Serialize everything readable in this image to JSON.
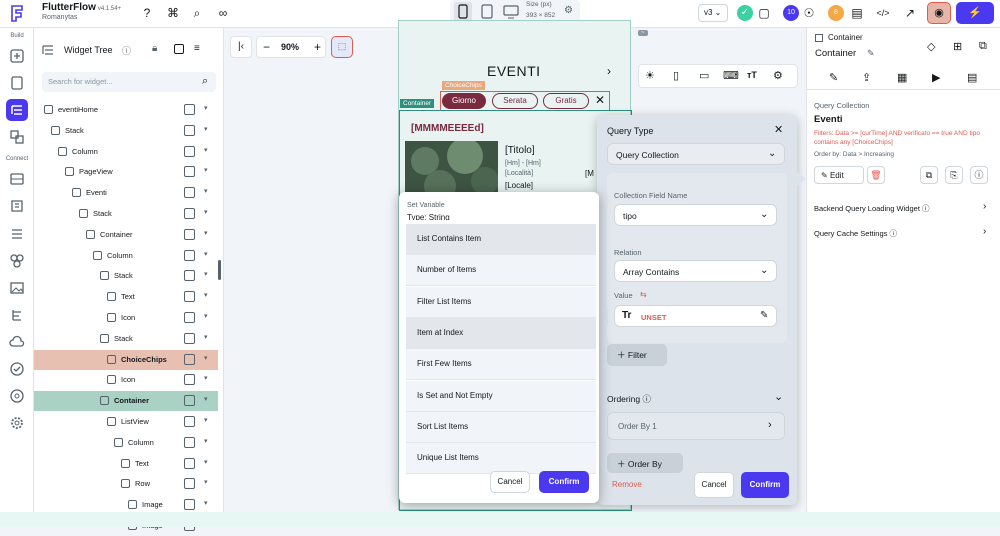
{
  "app": {
    "name": "FlutterFlow",
    "version": "v4.1.54+",
    "project": "Romanytas"
  },
  "topbar": {
    "size_label": "Size (px)",
    "size_value": "393 × 852",
    "version_select": "v3",
    "badge_count_1": "10",
    "badge_count_2": "8"
  },
  "rail": {
    "build_label": "Build",
    "connect_label": "Connect"
  },
  "widget_tree": {
    "title": "Widget Tree",
    "search_placeholder": "Search for widget...",
    "rows": [
      {
        "label": "eventiHome",
        "indent": 0
      },
      {
        "label": "Stack",
        "indent": 1
      },
      {
        "label": "Column",
        "indent": 2
      },
      {
        "label": "PageView",
        "indent": 3
      },
      {
        "label": "Eventi",
        "indent": 4
      },
      {
        "label": "Stack",
        "indent": 5
      },
      {
        "label": "Container",
        "indent": 6
      },
      {
        "label": "Column",
        "indent": 7
      },
      {
        "label": "Stack",
        "indent": 8
      },
      {
        "label": "Text",
        "indent": 9
      },
      {
        "label": "Icon",
        "indent": 9
      },
      {
        "label": "Stack",
        "indent": 8
      },
      {
        "label": "ChoiceChips",
        "indent": 9
      },
      {
        "label": "Icon",
        "indent": 9
      },
      {
        "label": "Container",
        "indent": 8
      },
      {
        "label": "ListView",
        "indent": 9
      },
      {
        "label": "Column",
        "indent": 10
      },
      {
        "label": "Text",
        "indent": 11
      },
      {
        "label": "Row",
        "indent": 11
      },
      {
        "label": "Image",
        "indent": 12
      },
      {
        "label": "Image",
        "indent": 12
      }
    ]
  },
  "canvas": {
    "zoom": "90%",
    "page_title": "EVENTI",
    "chip_label_tag": "ChoiceChips",
    "container_tag": "Container",
    "chips": [
      "Giorno",
      "Serata",
      "Gratis"
    ],
    "card_title": "[MMMMEEEEd]",
    "card_text_1": "[Titolo]",
    "card_text_2": "[Hm] - [Hm]",
    "card_text_3": "[Località]",
    "card_text_4": "[Locale]",
    "card_text_5": "[M"
  },
  "right_panel": {
    "widget_type": "Container",
    "widget_name": "Container",
    "query_collection_label": "Query Collection",
    "collection_name": "Eventi",
    "filters_text": "Filters: Data >= [curTime] AND verificato == true AND tipo contains any [ChoiceChips]",
    "order_text": "Order by: Data > Increasing",
    "edit_label": "Edit",
    "backend_loading_label": "Backend Query Loading Widget",
    "cache_label": "Query Cache Settings"
  },
  "query_popup": {
    "query_type_label": "Query Type",
    "query_type_value": "Query Collection",
    "field_name_label": "Collection Field Name",
    "field_name_value": "tipo",
    "relation_label": "Relation",
    "relation_value": "Array Contains",
    "value_label": "Value",
    "value_text": "UNSET",
    "filter_button": "Filter",
    "ordering_label": "Ordering",
    "order_by_item": "Order By 1",
    "order_by_button": "Order By",
    "remove_label": "Remove",
    "cancel_label": "Cancel",
    "confirm_label": "Confirm"
  },
  "variable_popup": {
    "title": "Set Variable",
    "type_text": "Type: String",
    "items": [
      "List Contains Item",
      "Number of Items",
      "Filter List Items",
      "Item at Index",
      "First Few Items",
      "Is Set and Not Empty",
      "Sort List Items",
      "Unique List Items"
    ],
    "cancel_label": "Cancel",
    "confirm_label": "Confirm"
  },
  "colors": {
    "primary": "#4b39ef",
    "orange_sel": "#e8c0b2",
    "teal_sel": "#a9d2c4",
    "chip": "#7a2a3f",
    "unset": "#e05a4e"
  }
}
